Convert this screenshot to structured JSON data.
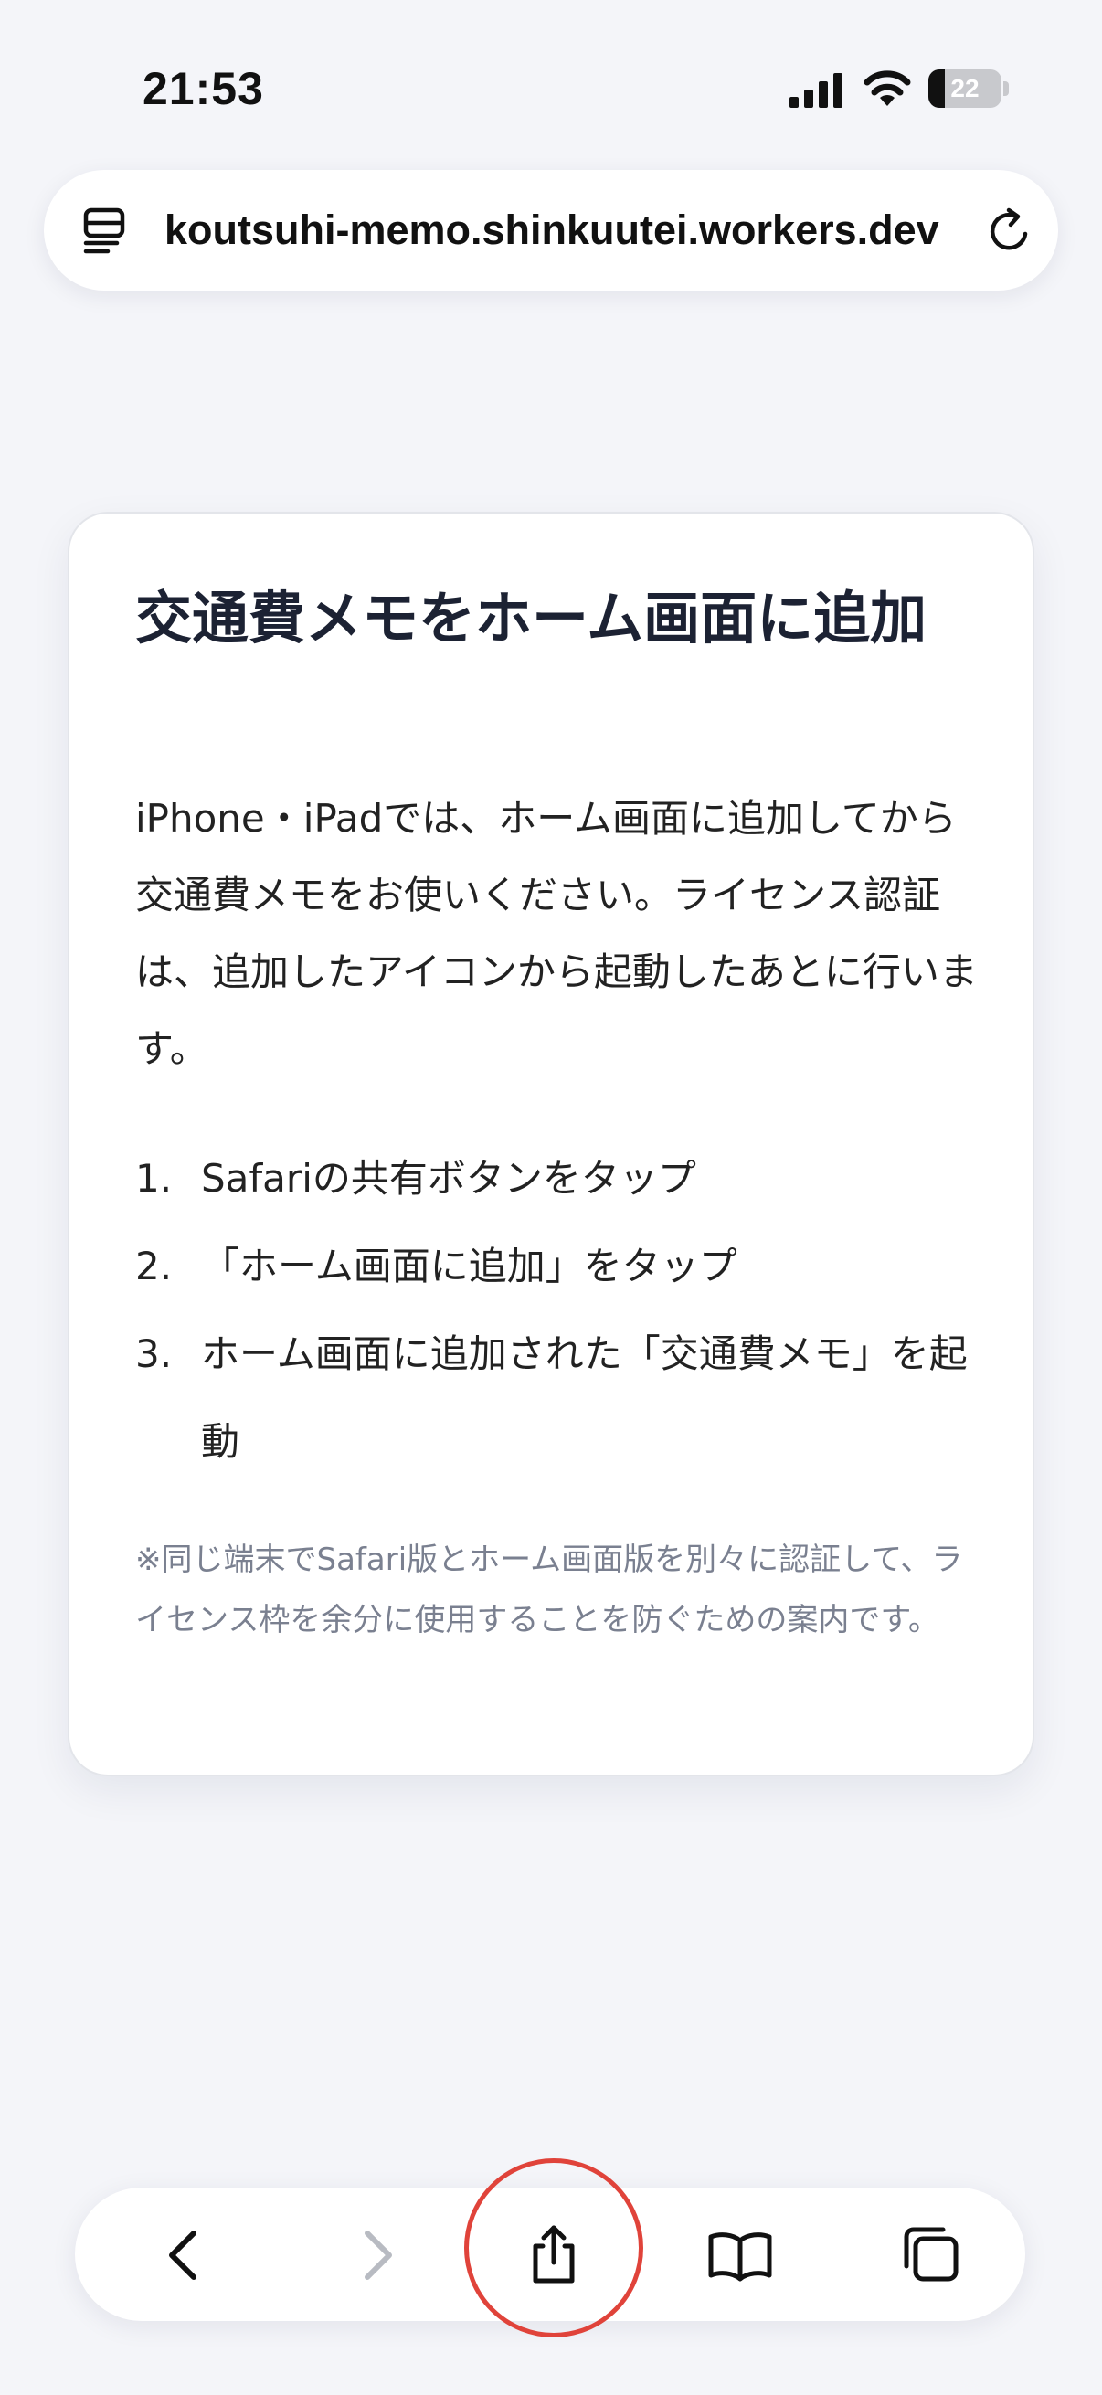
{
  "status_bar": {
    "time": "21:53",
    "battery_level": "22",
    "battery_fraction": 0.22
  },
  "browser": {
    "url": "koutsuhi-memo.shinkuutei.workers.dev",
    "icons": {
      "page_menu": "page-menu-icon",
      "reload": "reload-icon"
    }
  },
  "card": {
    "title": "交通費メモをホーム画面に追加",
    "intro": "iPhone・iPadでは、ホーム画面に追加してから交通費メモをお使いください。ライセンス認証は、追加したアイコンから起動したあとに行います。",
    "steps": [
      {
        "num": "1.",
        "text": "Safariの共有ボタンをタップ"
      },
      {
        "num": "2.",
        "text": "「ホーム画面に追加」をタップ"
      },
      {
        "num": "3.",
        "text": "ホーム画面に追加された「交通費メモ」を起動"
      }
    ],
    "note": "※同じ端末でSafari版とホーム画面版を別々に認証して、ライセンス枠を余分に使用することを防ぐための案内です。"
  },
  "toolbar": {
    "buttons": [
      "back-icon",
      "forward-icon",
      "share-icon",
      "bookmarks-icon",
      "tabs-icon"
    ],
    "highlight_color": "#e0433a"
  },
  "colors": {
    "background": "#f4f5f9",
    "card": "#ffffff",
    "title_text": "#1c2233",
    "note_text": "#7a8090"
  }
}
